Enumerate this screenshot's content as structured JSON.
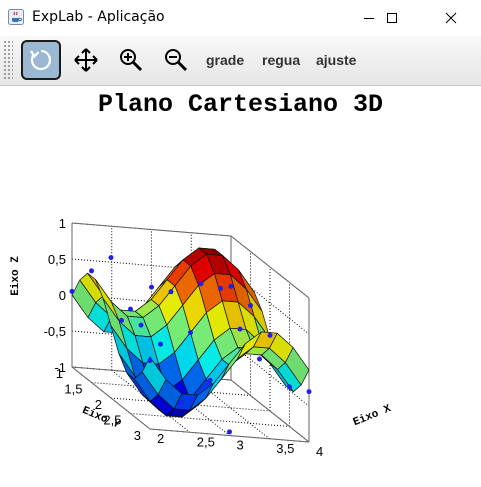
{
  "window": {
    "title": "ExpLab - Aplicação",
    "icon": "java-cup-icon"
  },
  "toolbar": {
    "buttons": [
      {
        "name": "rotate",
        "icon": "rotate-icon",
        "active": true
      },
      {
        "name": "pan",
        "icon": "move-arrows-icon",
        "active": false
      },
      {
        "name": "zoom-in",
        "icon": "zoom-in-icon",
        "active": false
      },
      {
        "name": "zoom-out",
        "icon": "zoom-out-icon",
        "active": false
      }
    ],
    "grade_label": "grade",
    "regua_label": "regua",
    "ajuste_label": "ajuste"
  },
  "colors": {
    "active_button_bg": "#9bb8d3",
    "data_point": "#2020ee"
  },
  "chart_data": {
    "type": "surface3d",
    "title": "Plano Cartesiano 3D",
    "xlabel": "Eixo X",
    "ylabel": "Eixo Y",
    "zlabel": "Eixo Z",
    "xlim": [
      2,
      4
    ],
    "ylim": [
      1,
      3
    ],
    "zlim": [
      -1,
      1
    ],
    "x_ticks": [
      "2",
      "2,5",
      "3",
      "3,5",
      "4"
    ],
    "y_ticks": [
      "1",
      "1,5",
      "2",
      "2,5",
      "3"
    ],
    "z_ticks": [
      "-1",
      "-0,5",
      "0",
      "0,5",
      "1"
    ],
    "surface": "z = (sin(pi*(x-3)) - sin(pi*(y-2))) / 2",
    "grid": true,
    "colormap": "jet",
    "scatter_points": [
      {
        "x": 2.0,
        "y": 1.0,
        "z": 0.05
      },
      {
        "x": 2.0,
        "y": 1.5,
        "z": 0.55
      },
      {
        "x": 2.0,
        "y": 2.0,
        "z": 0.95
      },
      {
        "x": 2.0,
        "y": 2.5,
        "z": 0.45
      },
      {
        "x": 2.0,
        "y": 3.0,
        "z": -0.05
      },
      {
        "x": 2.5,
        "y": 1.25,
        "z": -0.2
      },
      {
        "x": 2.5,
        "y": 1.75,
        "z": -0.05
      },
      {
        "x": 2.5,
        "y": 2.25,
        "z": -0.1
      },
      {
        "x": 2.5,
        "y": 2.75,
        "z": -0.7
      },
      {
        "x": 3.0,
        "y": 1.0,
        "z": 0.2
      },
      {
        "x": 3.0,
        "y": 1.5,
        "z": 0.35
      },
      {
        "x": 3.0,
        "y": 2.0,
        "z": 0.0
      },
      {
        "x": 3.0,
        "y": 2.5,
        "z": -0.45
      },
      {
        "x": 3.0,
        "y": 3.0,
        "z": -0.95
      },
      {
        "x": 3.5,
        "y": 1.25,
        "z": 0.4
      },
      {
        "x": 3.5,
        "y": 1.75,
        "z": 0.55
      },
      {
        "x": 3.5,
        "y": 2.25,
        "z": 0.2
      },
      {
        "x": 3.5,
        "y": 2.75,
        "z": 0.0
      },
      {
        "x": 4.0,
        "y": 1.0,
        "z": 0.3
      },
      {
        "x": 4.0,
        "y": 1.5,
        "z": 0.25
      },
      {
        "x": 4.0,
        "y": 2.0,
        "z": 0.05
      },
      {
        "x": 4.0,
        "y": 2.5,
        "z": -0.45
      },
      {
        "x": 4.0,
        "y": 3.0,
        "z": -0.3
      }
    ]
  }
}
